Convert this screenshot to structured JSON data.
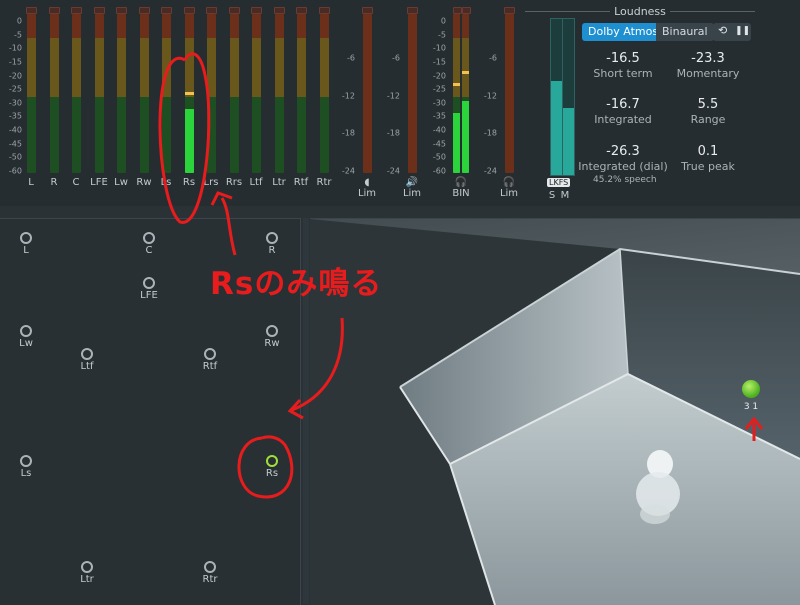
{
  "db_scale_left": [
    "0",
    "-5",
    "-10",
    "-15",
    "-20",
    "-25",
    "-30",
    "-35",
    "-40",
    "-45",
    "-50",
    "-60"
  ],
  "db_scale_lim": [
    "-6",
    "-12",
    "-18",
    "-24"
  ],
  "db_scale_bin": [
    "0",
    "-5",
    "-10",
    "-15",
    "-20",
    "-25",
    "-30",
    "-35",
    "-40",
    "-45",
    "-50",
    "-60"
  ],
  "channels": [
    "L",
    "R",
    "C",
    "LFE",
    "Lw",
    "Rw",
    "Ls",
    "Rs",
    "Lrs",
    "Rrs",
    "Ltf",
    "Ltr",
    "Rtf",
    "Rtr"
  ],
  "active_channel_index": 7,
  "active_channel_level": 0.4,
  "output_labels": [
    "Lim",
    "Lim",
    "BIN",
    "Lim"
  ],
  "bin_levels": [
    0.38,
    0.45
  ],
  "lkfs": {
    "tag": "LKFS",
    "s_label": "S",
    "m_label": "M",
    "s_level": 0.6,
    "m_level": 0.43
  },
  "loudness": {
    "title": "Loudness",
    "mode_buttons": [
      "Dolby Atmos",
      "Binaural"
    ],
    "active_mode": "Dolby Atmos",
    "reset_icon": "reset-icon",
    "pause_icon": "pause-icon",
    "short_term": {
      "value": "-16.5",
      "label": "Short term"
    },
    "momentary": {
      "value": "-23.3",
      "label": "Momentary"
    },
    "integrated": {
      "value": "-16.7",
      "label": "Integrated"
    },
    "range": {
      "value": "5.5",
      "label": "Range"
    },
    "integrated_dial": {
      "value": "-26.3",
      "label": "Integrated (dial)"
    },
    "true_peak": {
      "value": "0.1",
      "label": "True peak"
    },
    "speech": "45.2% speech"
  },
  "speakers": [
    {
      "label": "L"
    },
    {
      "label": "C"
    },
    {
      "label": "R"
    },
    {
      "label": "LFE"
    },
    {
      "label": "Lw"
    },
    {
      "label": "Rw"
    },
    {
      "label": "Ltf"
    },
    {
      "label": "Rtf"
    },
    {
      "label": "Ls"
    },
    {
      "label": "Rs"
    },
    {
      "label": "Ltr"
    },
    {
      "label": "Rtr"
    }
  ],
  "active_speaker": "Rs",
  "room": {
    "object_label": "3 1"
  },
  "annotation": {
    "text": "Rsのみ鳴る"
  },
  "colors": {
    "accent": "#1e8fd0",
    "meter_green": "#2bd43a",
    "active_speaker": "#9fe03a",
    "annotation_red": "#e81c1c"
  }
}
